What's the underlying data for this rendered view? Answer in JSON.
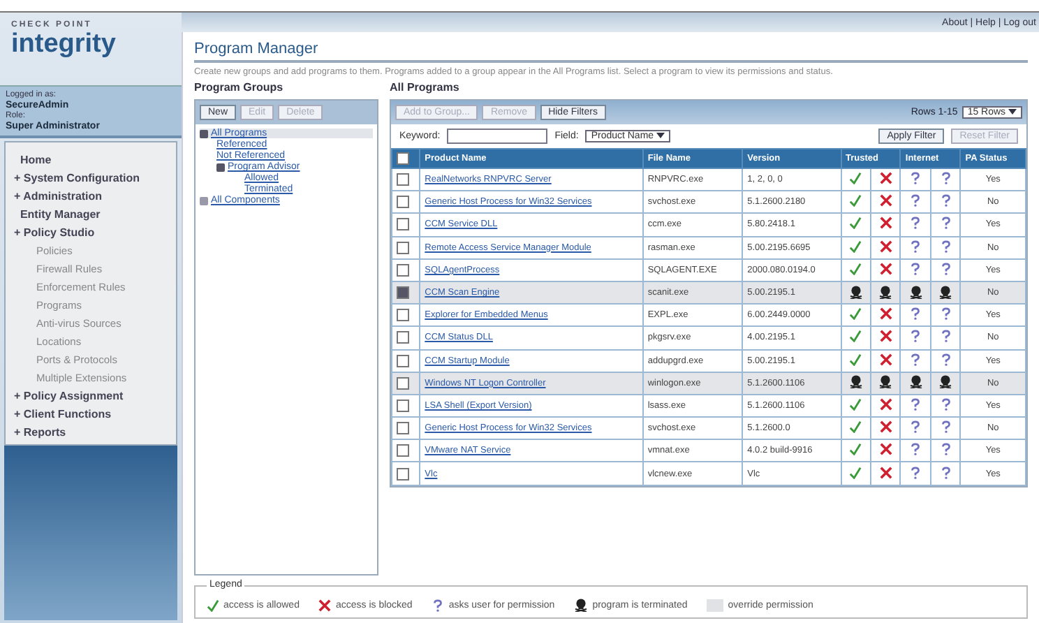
{
  "header": {
    "brand_top": "CHECK POINT",
    "brand": "integrity",
    "links": "About | Help | Log out"
  },
  "user": {
    "login_label": "Logged in as:",
    "login": "SecureAdmin",
    "role_label": "Role:",
    "role": "Super Administrator"
  },
  "nav": [
    {
      "label": "Home"
    },
    {
      "label": "System Configuration",
      "prefix": "+"
    },
    {
      "label": "Administration",
      "prefix": "+"
    },
    {
      "label": "Entity Manager"
    },
    {
      "label": "Policy Studio",
      "prefix": "+",
      "children": [
        {
          "label": "Policies"
        },
        {
          "label": "Firewall Rules"
        },
        {
          "label": "Enforcement Rules"
        },
        {
          "label": "Programs"
        },
        {
          "label": "Anti-virus Sources"
        },
        {
          "label": "Locations"
        },
        {
          "label": "Ports & Protocols"
        },
        {
          "label": "Multiple Extensions"
        }
      ]
    },
    {
      "label": "Policy Assignment",
      "prefix": "+"
    },
    {
      "label": "Client Functions",
      "prefix": "+"
    },
    {
      "label": "Reports",
      "prefix": "+"
    }
  ],
  "page": {
    "title": "Program Manager",
    "description": "Create new groups and add programs to them. Programs added to a group appear in the All Programs list. Select a program to view its permissions and status."
  },
  "groups": {
    "title": "Program Groups",
    "buttons": [
      {
        "label": "New",
        "disabled": false
      },
      {
        "label": "Edit",
        "disabled": true
      },
      {
        "label": "Delete",
        "disabled": true
      }
    ],
    "tree": [
      {
        "label": "All Programs",
        "selected": true,
        "expanded": true,
        "children": [
          {
            "label": "Referenced",
            "selected": false
          },
          {
            "label": "Not Referenced",
            "selected": false
          },
          {
            "label": "Program Advisor",
            "selected": false,
            "expanded": true,
            "children": [
              {
                "label": "Allowed",
                "selected": false
              },
              {
                "label": "Terminated",
                "selected": false
              }
            ]
          }
        ]
      },
      {
        "label": "All Components",
        "selected": false,
        "expanded": false
      }
    ]
  },
  "programs": {
    "title": "All Programs",
    "buttons": [
      {
        "label": "Add to Group...",
        "disabled": true
      },
      {
        "label": "Remove",
        "disabled": true
      },
      {
        "label": "Hide Filters",
        "disabled": false
      }
    ],
    "paging": "Rows 1-15",
    "rows_select": "15 Rows",
    "filter": {
      "keyword_label": "Keyword:",
      "field_label": "Field:",
      "field_value": "Product Name",
      "apply": "Apply Filter",
      "reset": "Reset Filter",
      "reset_disabled": true
    },
    "all_selected": false,
    "columns": [
      "Product Name",
      "File Name",
      "Version",
      "Trusted",
      "Internet",
      "PA Status"
    ],
    "rows": [
      {
        "name": "RealNetworks RNPVRC Server",
        "file": "RNPVRC.exe",
        "version": "1, 2, 0, 0",
        "perms": [
          {
            "kind": "allowed"
          },
          {
            "kind": "blocked"
          },
          {
            "kind": "ask"
          },
          {
            "kind": "ask"
          }
        ],
        "status": "Yes",
        "selected": false,
        "override": false
      },
      {
        "name": "Generic Host Process for Win32 Services",
        "file": "svchost.exe",
        "version": "5.1.2600.2180",
        "perms": [
          {
            "kind": "allowed"
          },
          {
            "kind": "blocked"
          },
          {
            "kind": "ask"
          },
          {
            "kind": "ask"
          }
        ],
        "status": "No",
        "selected": false,
        "override": false
      },
      {
        "name": "CCM Service DLL",
        "file": "ccm.exe",
        "version": "5.80.2418.1",
        "perms": [
          {
            "kind": "allowed"
          },
          {
            "kind": "blocked"
          },
          {
            "kind": "ask"
          },
          {
            "kind": "ask"
          }
        ],
        "status": "Yes",
        "selected": false,
        "override": false
      },
      {
        "name": "Remote Access Service Manager Module",
        "file": "rasman.exe",
        "version": "5.00.2195.6695",
        "perms": [
          {
            "kind": "allowed"
          },
          {
            "kind": "blocked"
          },
          {
            "kind": "ask"
          },
          {
            "kind": "ask"
          }
        ],
        "status": "No",
        "selected": false,
        "override": false
      },
      {
        "name": "SQLAgentProcess",
        "file": "SQLAGENT.EXE",
        "version": "2000.080.0194.0",
        "perms": [
          {
            "kind": "allowed"
          },
          {
            "kind": "blocked"
          },
          {
            "kind": "ask"
          },
          {
            "kind": "ask"
          }
        ],
        "status": "Yes",
        "selected": false,
        "override": false
      },
      {
        "name": "CCM Scan Engine",
        "file": "scanit.exe",
        "version": "5.00.2195.1",
        "perms": [
          {
            "kind": "terminated"
          },
          {
            "kind": "terminated"
          },
          {
            "kind": "terminated"
          },
          {
            "kind": "terminated"
          }
        ],
        "status": "No",
        "selected": true,
        "override": true
      },
      {
        "name": "Explorer for Embedded Menus",
        "file": "EXPL.exe",
        "version": "6.00.2449.0000",
        "perms": [
          {
            "kind": "allowed"
          },
          {
            "kind": "blocked"
          },
          {
            "kind": "ask"
          },
          {
            "kind": "ask"
          }
        ],
        "status": "Yes",
        "selected": false,
        "override": false
      },
      {
        "name": "CCM Status DLL",
        "file": "pkgsrv.exe",
        "version": "4.00.2195.1",
        "perms": [
          {
            "kind": "allowed"
          },
          {
            "kind": "blocked"
          },
          {
            "kind": "ask"
          },
          {
            "kind": "ask"
          }
        ],
        "status": "No",
        "selected": false,
        "override": false
      },
      {
        "name": "CCM Startup Module",
        "file": "addupgrd.exe",
        "version": "5.00.2195.1",
        "perms": [
          {
            "kind": "allowed"
          },
          {
            "kind": "blocked"
          },
          {
            "kind": "ask"
          },
          {
            "kind": "ask"
          }
        ],
        "status": "Yes",
        "selected": false,
        "override": false
      },
      {
        "name": "Windows NT Logon Controller",
        "file": "winlogon.exe",
        "version": "5.1.2600.1106",
        "perms": [
          {
            "kind": "terminated"
          },
          {
            "kind": "terminated"
          },
          {
            "kind": "terminated"
          },
          {
            "kind": "terminated"
          }
        ],
        "status": "No",
        "selected": false,
        "override": true
      },
      {
        "name": "LSA Shell (Export Version)",
        "file": "lsass.exe",
        "version": "5.1.2600.1106",
        "perms": [
          {
            "kind": "allowed"
          },
          {
            "kind": "blocked"
          },
          {
            "kind": "ask"
          },
          {
            "kind": "ask"
          }
        ],
        "status": "Yes",
        "selected": false,
        "override": false
      },
      {
        "name": "Generic Host Process for Win32 Services",
        "file": "svchost.exe",
        "version": "5.1.2600.0",
        "perms": [
          {
            "kind": "allowed"
          },
          {
            "kind": "blocked"
          },
          {
            "kind": "ask"
          },
          {
            "kind": "ask"
          }
        ],
        "status": "No",
        "selected": false,
        "override": false
      },
      {
        "name": "VMware NAT Service",
        "file": "vmnat.exe",
        "version": "4.0.2 build-9916",
        "perms": [
          {
            "kind": "allowed"
          },
          {
            "kind": "blocked"
          },
          {
            "kind": "ask"
          },
          {
            "kind": "ask"
          }
        ],
        "status": "Yes",
        "selected": false,
        "override": false
      },
      {
        "name": "Vlc",
        "file": "vlcnew.exe",
        "version": "Vlc",
        "perms": [
          {
            "kind": "allowed"
          },
          {
            "kind": "blocked"
          },
          {
            "kind": "ask"
          },
          {
            "kind": "ask"
          }
        ],
        "status": "Yes",
        "selected": false,
        "override": false
      }
    ]
  },
  "legend": {
    "title": "Legend",
    "items": [
      {
        "kind": "allowed",
        "label": "access is allowed"
      },
      {
        "kind": "blocked",
        "label": "access is blocked"
      },
      {
        "kind": "ask",
        "label": "asks user for permission"
      },
      {
        "kind": "terminated",
        "label": "program is terminated"
      },
      {
        "kind": "override",
        "label": "override permission"
      }
    ]
  }
}
